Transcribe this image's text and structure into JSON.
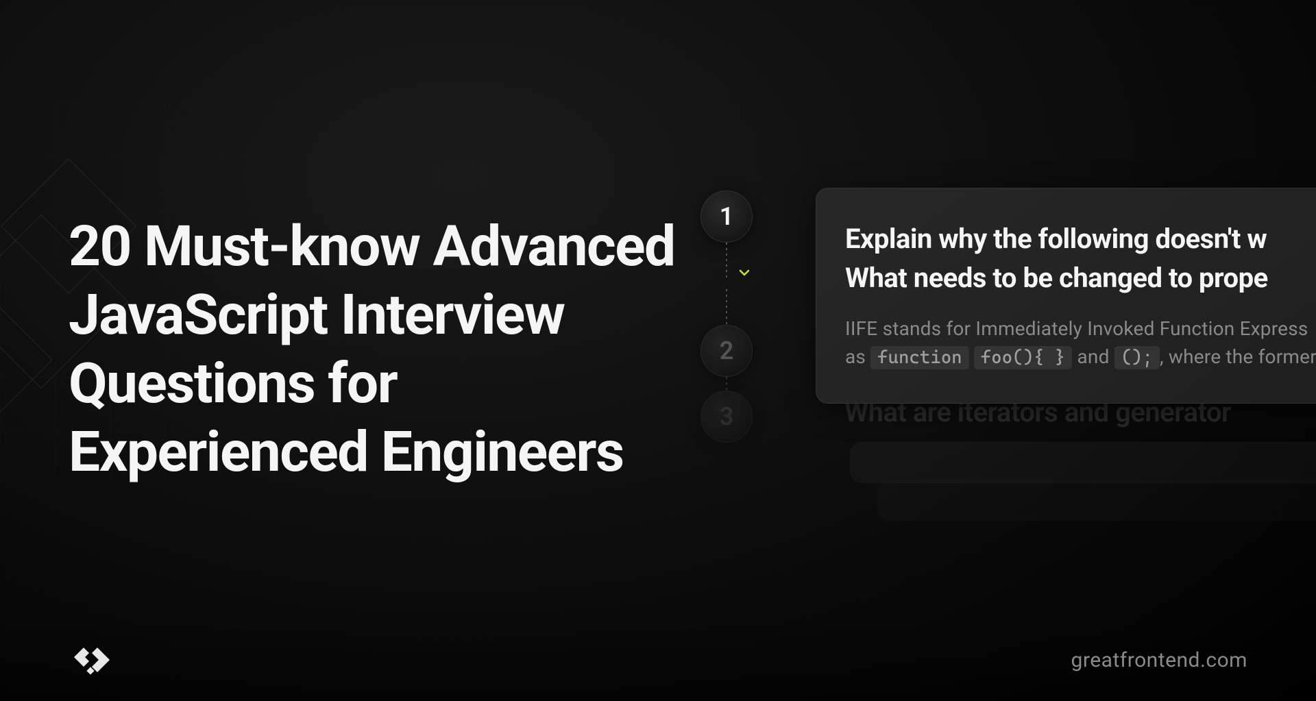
{
  "title": "20 Must-know Advanced JavaScript Interview Questions for Experienced Engineers",
  "steps": {
    "items": [
      "1",
      "2",
      "3"
    ]
  },
  "card": {
    "question_line1": "Explain why the following doesn't w",
    "question_line2": "What needs to be changed to prope",
    "answer_pre": "IIFE stands for Immediately Invoked Function Express",
    "answer_mid1": "as ",
    "code1": "function",
    "code2": "foo(){ }",
    "answer_mid2": " and ",
    "code3": "();",
    "answer_post": ", where the former i"
  },
  "peek": {
    "text": "What are iterators and generator"
  },
  "footer": {
    "url": "greatfrontend.com"
  }
}
